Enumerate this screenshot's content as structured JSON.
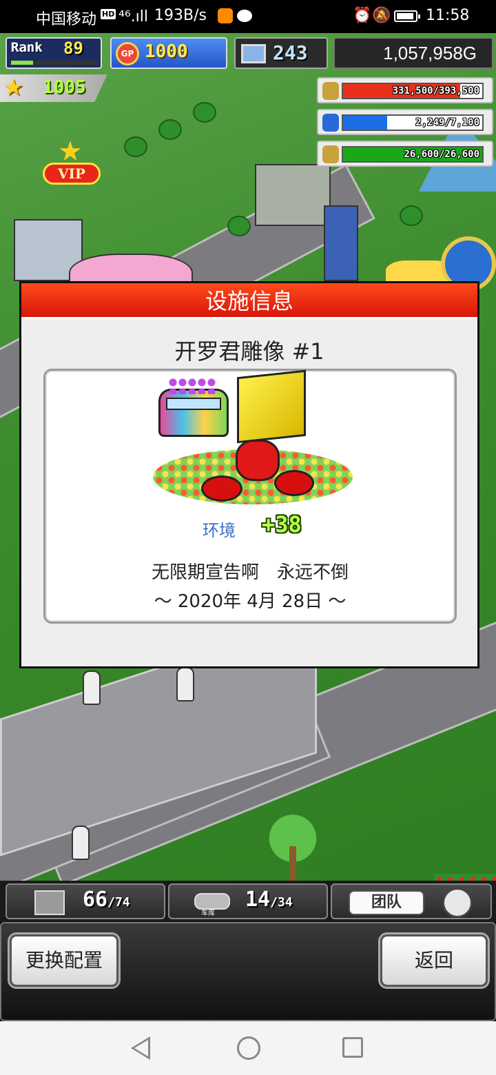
{
  "status_bar": {
    "carrier": "中国移动",
    "hd": "HD",
    "signal": "⁴⁶.ıll",
    "speed": "193B/s",
    "alarm_icon": "⏰",
    "mute_icon": "🔕",
    "time": "11:58"
  },
  "hud": {
    "rank_label": "Rank",
    "rank_value": "89",
    "rank_progress": 0.25,
    "gp_symbol": "GP",
    "gp_value": "1000",
    "research_value": "243",
    "money": "1,057,958G",
    "star_value": "1005",
    "resources": [
      {
        "icon": "coin-stack-icon",
        "text": "331,500/393,500",
        "fraction": 0.842,
        "color": "#e8301a"
      },
      {
        "icon": "fuel-can-icon",
        "text": "2,249/7,100",
        "fraction": 0.317,
        "color": "#1a6ee8"
      },
      {
        "icon": "wheat-icon",
        "text": "26,600/26,600",
        "fraction": 1.0,
        "color": "#1aa81a"
      }
    ],
    "vip_label": "VIP"
  },
  "dialog": {
    "title": "设施信息",
    "facility_name": "开罗君雕像 #1",
    "env_label": "环境",
    "env_value": "+38",
    "inscription_line1": "无限期宣告啊　永远不倒",
    "inscription_line2": "～ 2020年 4月 28日 ～"
  },
  "counters": {
    "slots_current": "66",
    "slots_max": "/74",
    "garage_label": "车库",
    "garage_current": "14",
    "garage_max": "/34",
    "team_label": "团队"
  },
  "actions": {
    "swap_config": "更换配置",
    "back": "返回"
  }
}
